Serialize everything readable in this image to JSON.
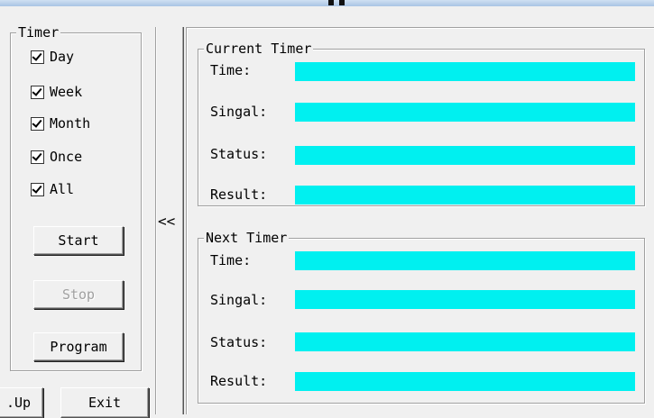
{
  "timer_group": {
    "label": "Timer",
    "options": [
      {
        "label": "Day",
        "checked": true
      },
      {
        "label": "Week",
        "checked": true
      },
      {
        "label": "Month",
        "checked": true
      },
      {
        "label": "Once",
        "checked": true
      },
      {
        "label": "All",
        "checked": true
      }
    ]
  },
  "buttons": {
    "start": "Start",
    "stop": "Stop",
    "program": "Program",
    "up": ".Up",
    "exit": "Exit"
  },
  "collapse_toggle": "<<",
  "current_timer": {
    "label": "Current Timer",
    "rows": [
      {
        "label": "Time:",
        "value": ""
      },
      {
        "label": "Singal:",
        "value": ""
      },
      {
        "label": "Status:",
        "value": ""
      },
      {
        "label": "Result:",
        "value": ""
      }
    ]
  },
  "next_timer": {
    "label": "Next Timer",
    "rows": [
      {
        "label": "Time:",
        "value": ""
      },
      {
        "label": "Singal:",
        "value": ""
      },
      {
        "label": "Status:",
        "value": ""
      },
      {
        "label": "Result:",
        "value": ""
      }
    ]
  },
  "colors": {
    "field_background": "#00f0f0",
    "window_background": "#f0f0f0"
  }
}
